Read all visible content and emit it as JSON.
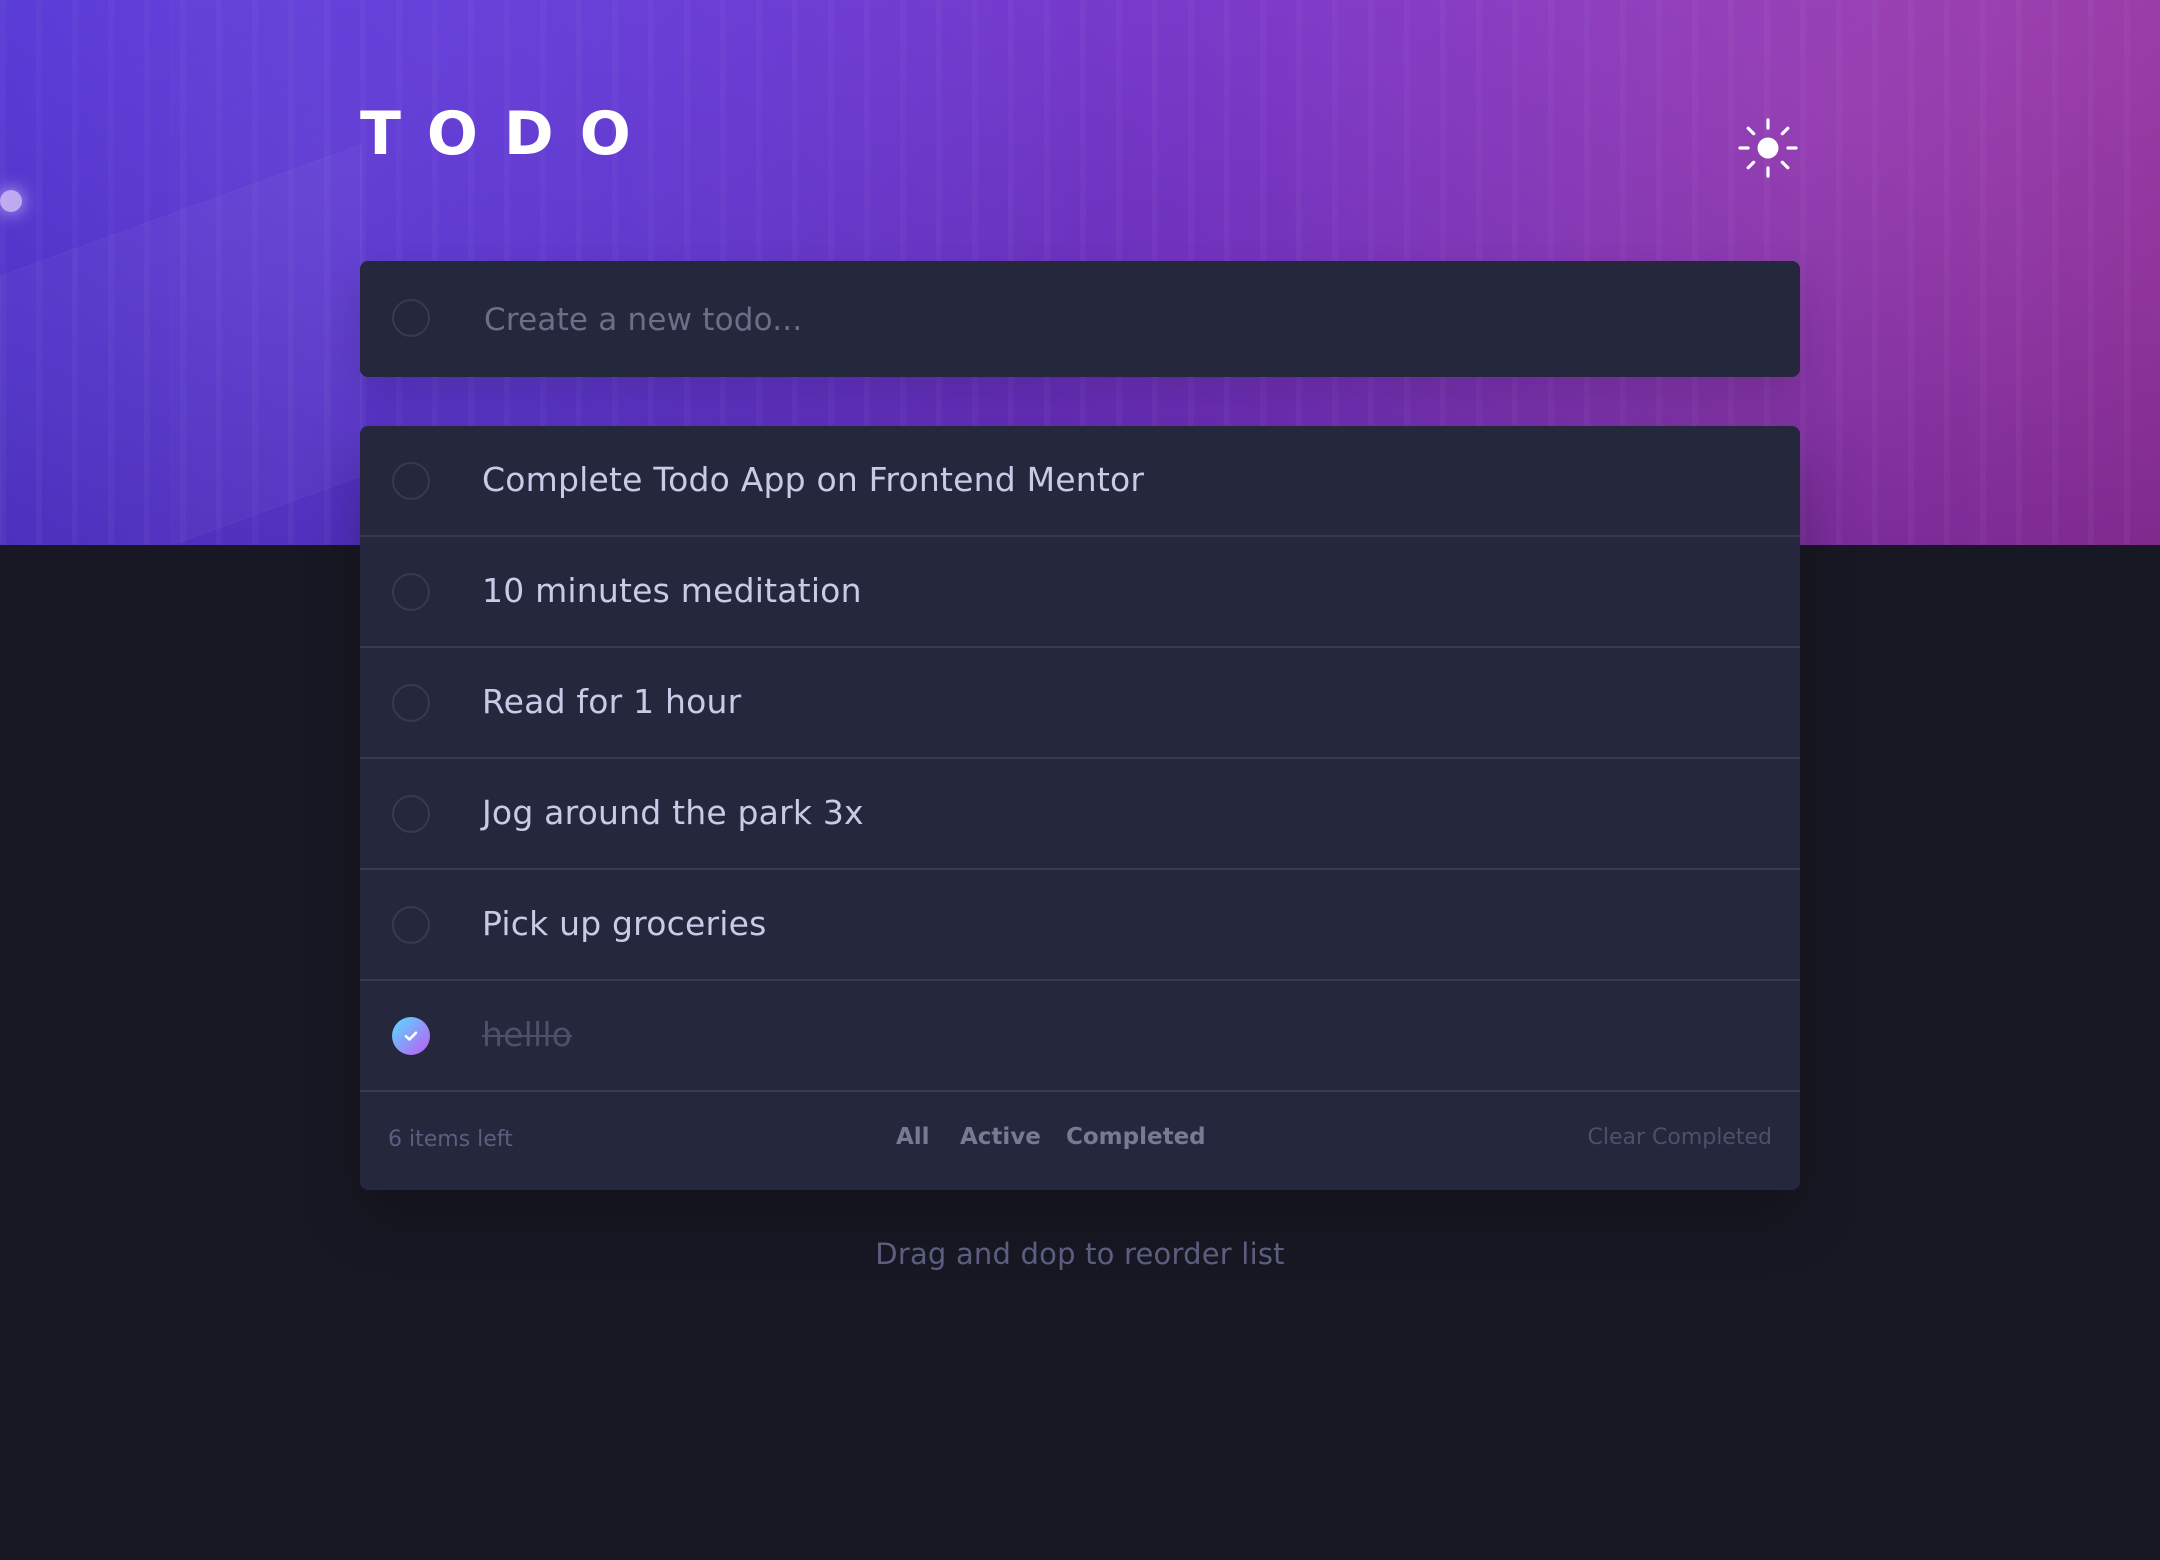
{
  "app": {
    "title": "TODO",
    "theme_toggle_icon": "sun-icon"
  },
  "new_todo": {
    "placeholder": "Create a new todo...",
    "value": ""
  },
  "todos": [
    {
      "text": "Complete Todo App on Frontend Mentor",
      "completed": false
    },
    {
      "text": "10 minutes meditation",
      "completed": false
    },
    {
      "text": "Read for 1 hour",
      "completed": false
    },
    {
      "text": "Jog around the park 3x",
      "completed": false
    },
    {
      "text": "Pick up groceries",
      "completed": false
    },
    {
      "text": "helllo",
      "completed": true
    }
  ],
  "footer": {
    "items_left": "6 items left",
    "filters": {
      "all": "All",
      "active": "Active",
      "completed": "Completed"
    },
    "clear_completed": "Clear Completed"
  },
  "hint": "Drag and dop to reorder list",
  "colors": {
    "page_bg": "#171823",
    "card_bg": "#25273d",
    "divider": "#393a4b",
    "text": "#c8cbe7",
    "muted": "#5b5e7e",
    "hero_start": "#4a2bd0",
    "hero_end": "#8f2d9f",
    "check_start": "#57ddff",
    "check_end": "#c058f3"
  }
}
